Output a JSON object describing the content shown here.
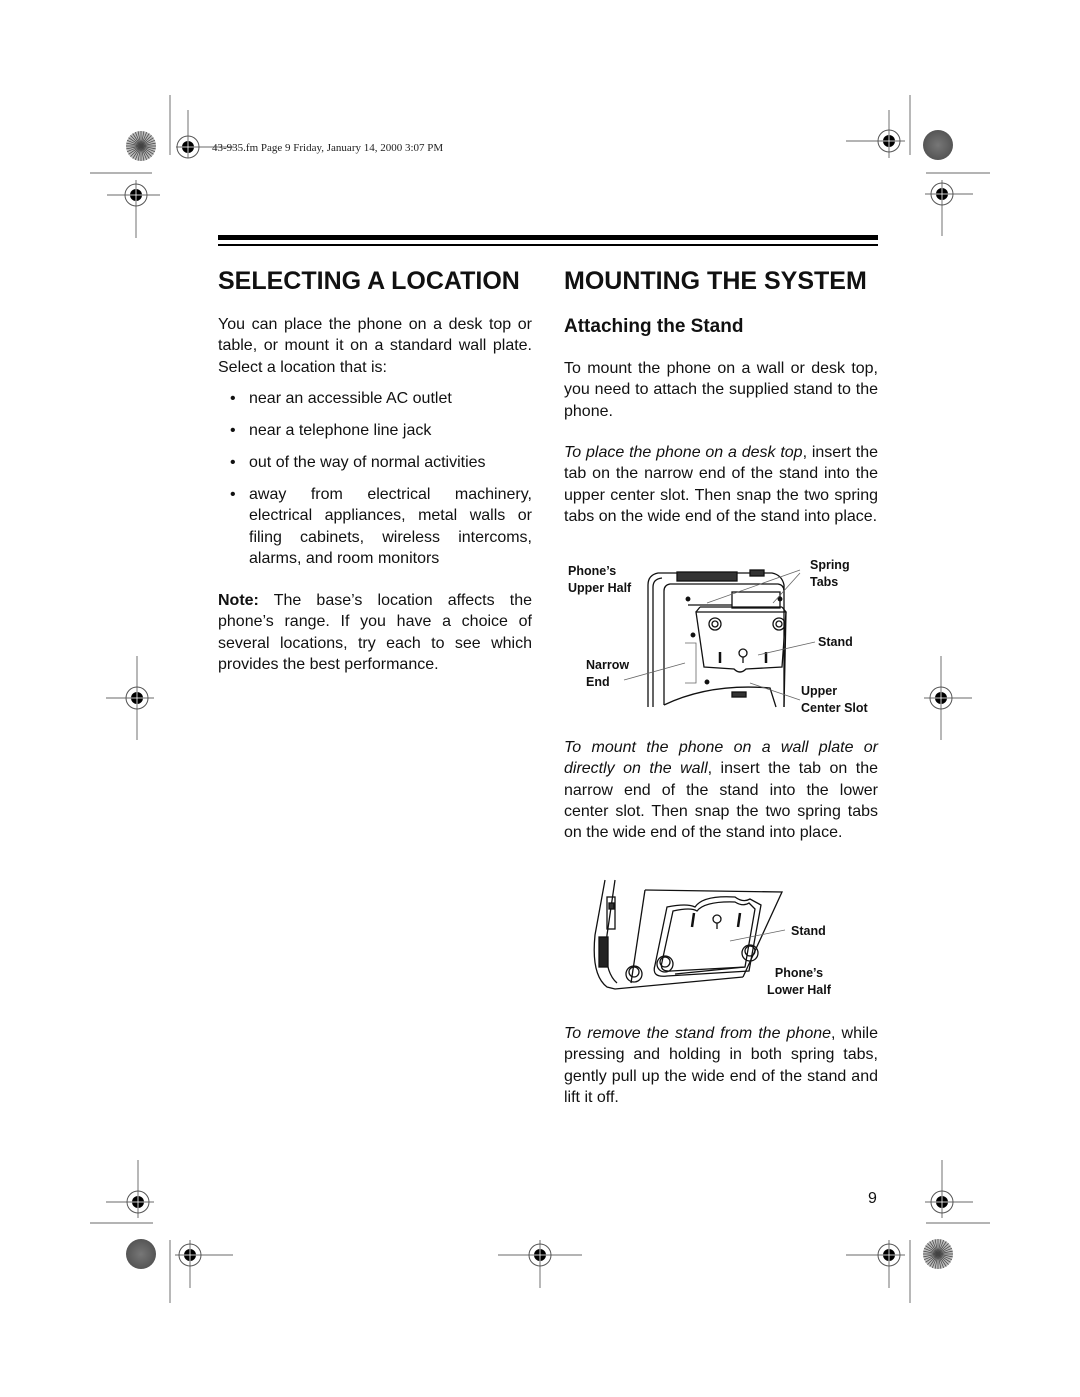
{
  "header": {
    "stamp": "43-935.fm  Page 9  Friday, January 14, 2000  3:07 PM"
  },
  "left_column": {
    "title": "SELECTING A LOCATION",
    "intro": "You can place the phone on a desk top or table, or mount it on a standard wall plate. Select a location that is:",
    "bullet_glyph": "•",
    "bullets": [
      "near an accessible AC outlet",
      "near a telephone line jack",
      "out of the way of normal activities",
      "away from electrical machinery, electrical appliances, metal walls or filing cabinets, wireless intercoms, alarms, and room monitors"
    ],
    "note": {
      "label": "Note:",
      "text": " The base’s location affects the phone’s range. If you have a choice of several locations, try each to see which provides the best performance."
    }
  },
  "right_column": {
    "title": "MOUNTING THE SYSTEM",
    "subtitle": "Attaching the Stand",
    "intro": "To mount the phone on a wall or desk top, you need to attach the supplied stand to the phone.",
    "desk": {
      "lead": "To place the phone on a desk top",
      "text": ", insert the tab on the narrow end of the stand into the upper center slot. Then snap the two spring tabs on the wide end of the stand into place."
    },
    "figure1": {
      "labels": {
        "upper_half_1": "Phone’s",
        "upper_half_2": "Upper Half",
        "spring_1": "Spring",
        "spring_2": "Tabs",
        "stand": "Stand",
        "narrow_1": "Narrow",
        "narrow_2": "End",
        "slot_1": "Upper",
        "slot_2": "Center Slot"
      }
    },
    "wall": {
      "lead": "To mount the phone on a wall plate or directly on the wall",
      "text": ", insert the tab on the narrow end of the stand into the lower center slot. Then snap the two spring tabs on the wide end of the stand into place."
    },
    "figure2": {
      "labels": {
        "stand": "Stand",
        "lower_half_1": "Phone’s",
        "lower_half_2": "Lower Half"
      }
    },
    "remove": {
      "lead": "To remove the stand from the phone",
      "text": ", while pressing and holding in both spring tabs, gently pull up the wide end of the stand and lift it off."
    }
  },
  "footer": {
    "page_number": "9"
  }
}
